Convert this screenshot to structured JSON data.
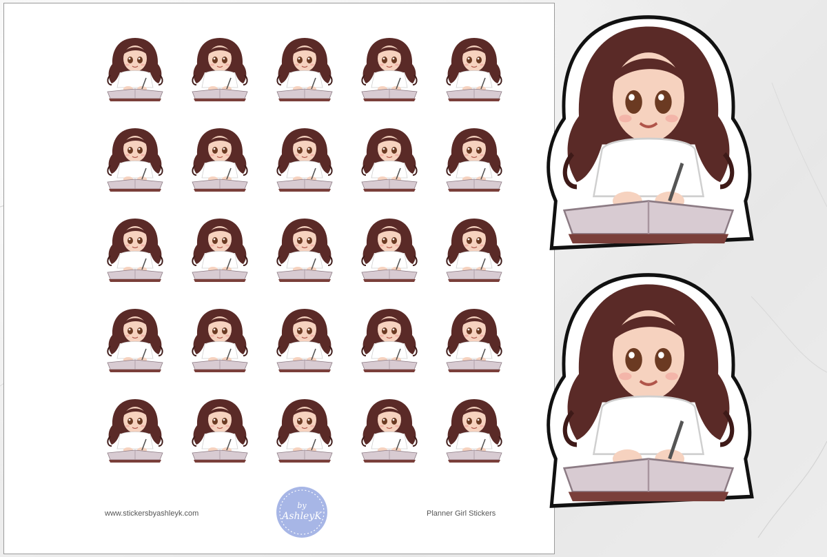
{
  "sheet": {
    "website": "www.stickersbyashleyk.com",
    "title": "Planner Girl Stickers",
    "logo": {
      "top": "by",
      "script": "AshleyK",
      "color": "#9fb0e0"
    },
    "sticker_rows": 5,
    "sticker_cols": 5
  },
  "palette": {
    "hair": "#5a2a27",
    "hair_dark": "#3e1a18",
    "skin": "#f6d2bf",
    "shirt": "#ffffff",
    "book": "#d8cbd2",
    "book_edge": "#7a3f3a"
  }
}
